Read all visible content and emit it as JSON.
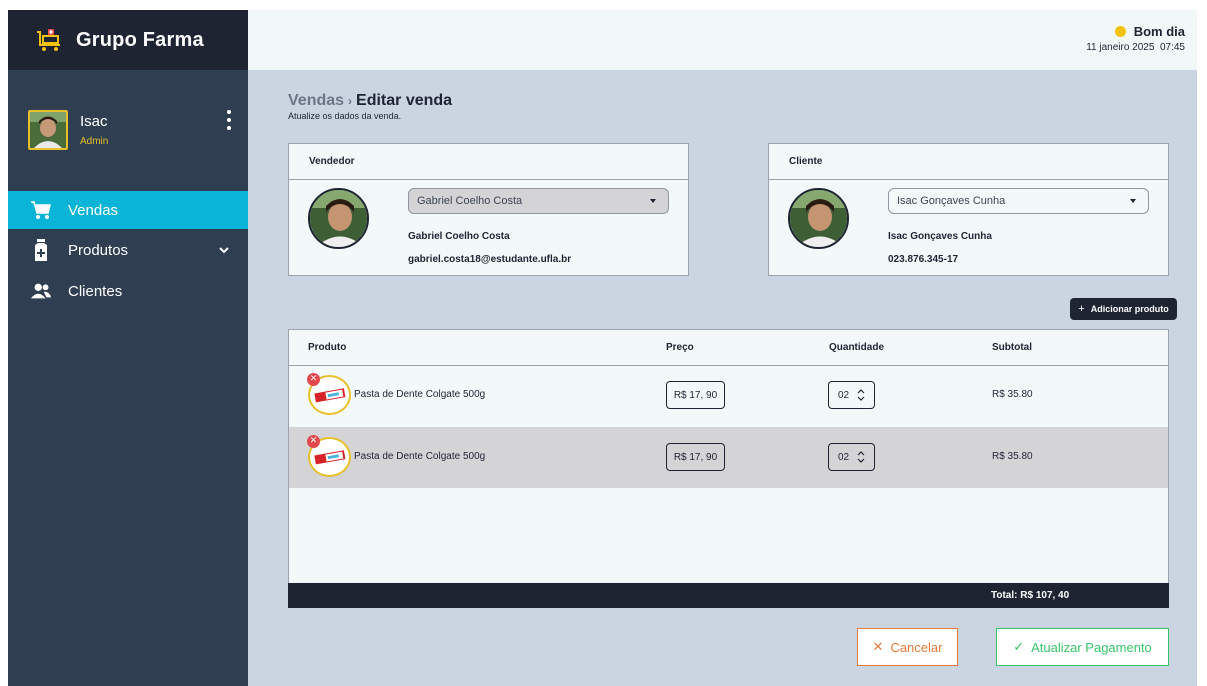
{
  "app": {
    "brand": "Grupo Farma"
  },
  "user": {
    "name": "Isac",
    "role": "Admin"
  },
  "sidebar": {
    "items": [
      {
        "label": "Vendas",
        "icon": "cart-icon",
        "active": true
      },
      {
        "label": "Produtos",
        "icon": "medicine-bottle-icon",
        "expandable": true
      },
      {
        "label": "Clientes",
        "icon": "users-icon"
      }
    ]
  },
  "header": {
    "greeting": "Bom dia",
    "datetime": "11 janeiro 2025  07:45"
  },
  "page": {
    "breadcrumb_parent": "Vendas",
    "breadcrumb_sep": "›",
    "breadcrumb_current": "Editar venda",
    "subtitle": "Atualize os dados da venda."
  },
  "seller": {
    "title": "Vendedor",
    "selected": "Gabriel Coelho Costa",
    "name": "Gabriel Coelho Costa",
    "email": "gabriel.costa18@estudante.ufla.br"
  },
  "client": {
    "title": "Cliente",
    "selected": "Isac Gonçaves Cunha",
    "name": "Isac Gonçaves Cunha",
    "cpf": "023.876.345-17"
  },
  "add_product_label": "Adicionar produto",
  "table": {
    "columns": [
      "Produto",
      "Preço",
      "Quantidade",
      "Subtotal"
    ],
    "rows": [
      {
        "product": "Pasta de Dente Colgate 500g",
        "price": "R$ 17, 90",
        "qty": "02",
        "subtotal": "R$ 35.80"
      },
      {
        "product": "Pasta de Dente Colgate 500g",
        "price": "R$ 17, 90",
        "qty": "02",
        "subtotal": "R$ 35.80"
      }
    ],
    "total": "Total: R$ 107, 40"
  },
  "actions": {
    "cancel": "Cancelar",
    "update": "Atualizar Pagamento"
  },
  "colors": {
    "sidebar": "#2f3e51",
    "brand_bar": "#1e2432",
    "active_nav": "#0ab4d6",
    "accent_yellow": "#e7c02b",
    "cancel": "#e67a3a",
    "update": "#38c56a",
    "main_bg": "#cbd4e1"
  }
}
